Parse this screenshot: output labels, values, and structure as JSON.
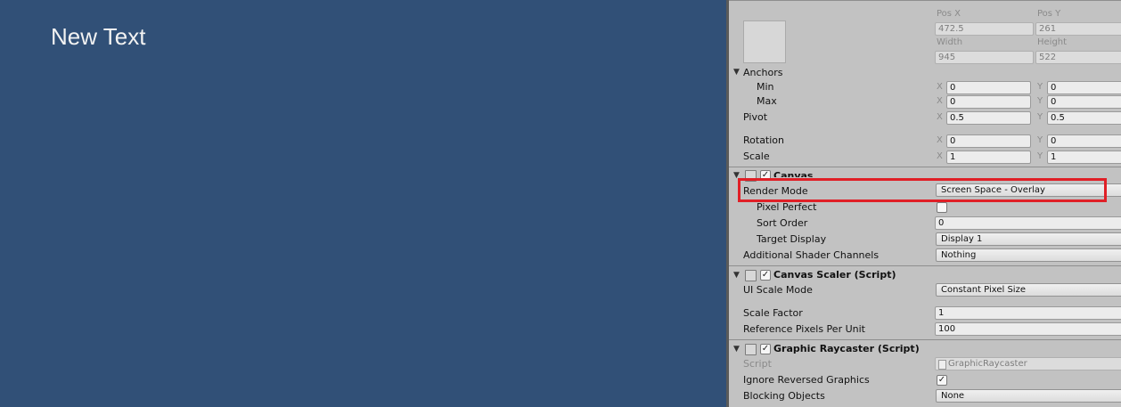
{
  "game_view": {
    "text": "New Text"
  },
  "rect_transform": {
    "pos_x_label": "Pos X",
    "pos_y_label": "Pos Y",
    "pos_x": "472.5",
    "pos_y": "261",
    "width_label": "Width",
    "height_label": "Height",
    "width": "945",
    "height": "522",
    "anchors_label": "Anchors",
    "min_label": "Min",
    "max_label": "Max",
    "min_x": "0",
    "min_y": "0",
    "max_x": "0",
    "max_y": "0",
    "pivot_label": "Pivot",
    "pivot_x": "0.5",
    "pivot_y": "0.5",
    "rotation_label": "Rotation",
    "rotation_x": "0",
    "rotation_y": "0",
    "scale_label": "Scale",
    "scale_x": "1",
    "scale_y": "1",
    "x_axis": "X",
    "y_axis": "Y"
  },
  "canvas": {
    "title": "Canvas",
    "enabled": "✓",
    "render_mode_label": "Render Mode",
    "render_mode": "Screen Space - Overlay",
    "pixel_perfect_label": "Pixel Perfect",
    "sort_order_label": "Sort Order",
    "sort_order": "0",
    "target_display_label": "Target Display",
    "target_display": "Display 1",
    "shader_channels_label": "Additional Shader Channels",
    "shader_channels": "Nothing"
  },
  "canvas_scaler": {
    "title": "Canvas Scaler (Script)",
    "enabled": "✓",
    "ui_scale_mode_label": "UI Scale Mode",
    "ui_scale_mode": "Constant Pixel Size",
    "scale_factor_label": "Scale Factor",
    "scale_factor": "1",
    "ref_pixels_label": "Reference Pixels Per Unit",
    "ref_pixels": "100"
  },
  "graphic_raycaster": {
    "title": "Graphic Raycaster (Script)",
    "enabled": "✓",
    "script_label": "Script",
    "script": "GraphicRaycaster",
    "ignore_reversed_label": "Ignore Reversed Graphics",
    "ignore_reversed": "✓",
    "blocking_objects_label": "Blocking Objects",
    "blocking_objects": "None"
  },
  "colors": {
    "game_bg": "#315077",
    "inspector_bg": "#c2c2c2",
    "highlight": "#e01f26"
  },
  "icons": [
    "foldout-arrow-icon",
    "component-icon",
    "checkbox-icon",
    "script-file-icon"
  ]
}
